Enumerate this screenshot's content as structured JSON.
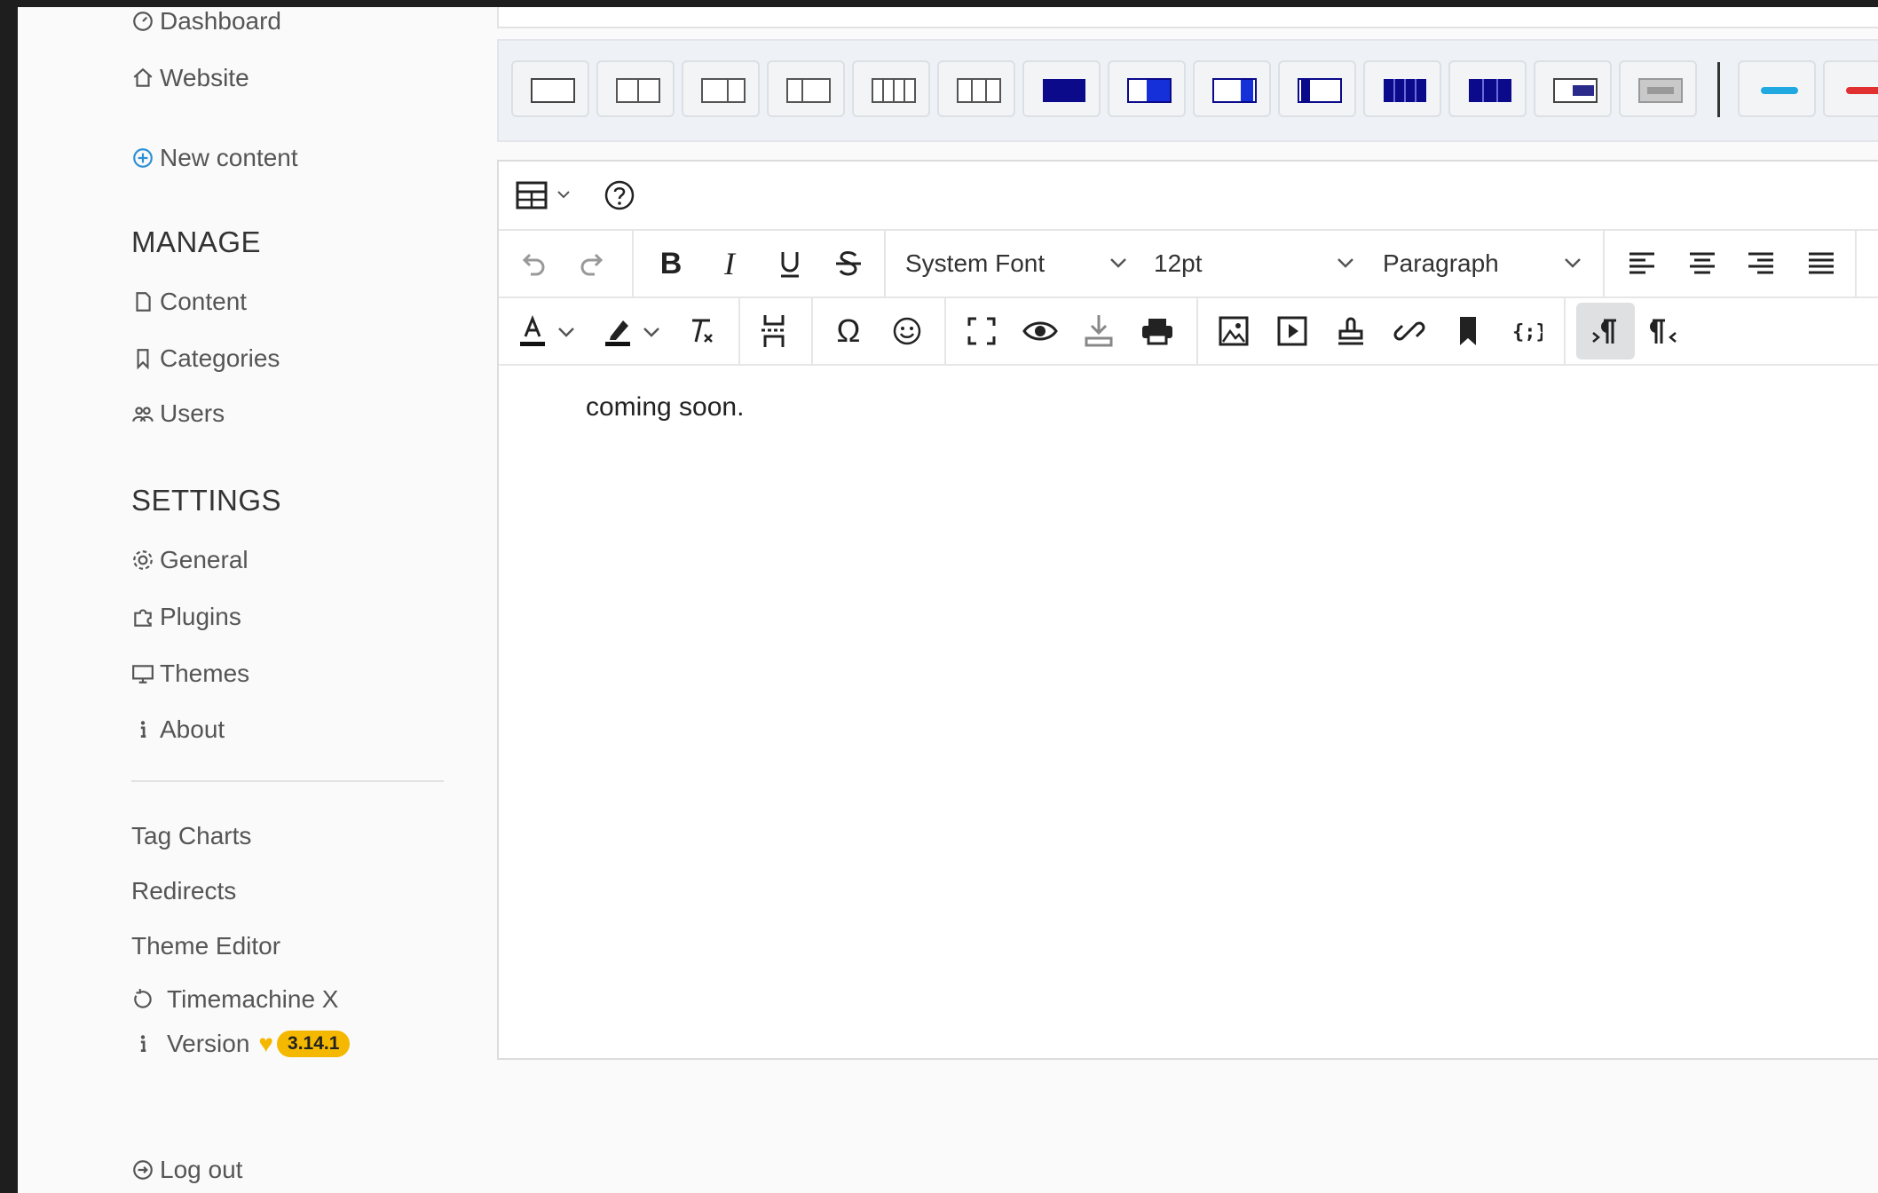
{
  "sidebar": {
    "top_items": [
      {
        "label": "Dashboard",
        "icon": "dashboard-icon"
      },
      {
        "label": "Website",
        "icon": "home-icon"
      },
      {
        "label": "New content",
        "icon": "plus-circle-icon"
      }
    ],
    "manage": {
      "heading": "MANAGE",
      "items": [
        {
          "label": "Content",
          "icon": "document-icon"
        },
        {
          "label": "Categories",
          "icon": "bookmark-icon"
        },
        {
          "label": "Users",
          "icon": "users-icon"
        }
      ]
    },
    "settings": {
      "heading": "SETTINGS",
      "items": [
        {
          "label": "General",
          "icon": "gear-icon"
        },
        {
          "label": "Plugins",
          "icon": "puzzle-icon"
        },
        {
          "label": "Themes",
          "icon": "monitor-icon"
        },
        {
          "label": "About",
          "icon": "info-icon"
        }
      ]
    },
    "plugins": [
      {
        "label": "Tag Charts"
      },
      {
        "label": "Redirects"
      },
      {
        "label": "Theme Editor"
      },
      {
        "label": "Timemachine X",
        "icon": "history-icon"
      }
    ],
    "version": {
      "label": "Version",
      "badge": "3.14.1",
      "icon": "info-icon",
      "heart_icon": "heart-icon"
    },
    "logout": {
      "label": "Log out",
      "icon": "logout-icon"
    }
  },
  "editor": {
    "font_family": "System Font",
    "font_size": "12pt",
    "block_format": "Paragraph",
    "content_text": "coming soon.",
    "layout_buttons": [
      "layout-1-col",
      "layout-2-col",
      "layout-2-col-right",
      "layout-2-col-left",
      "layout-4-col",
      "layout-3-col",
      "block-dark",
      "block-right-dark",
      "block-right-narrow",
      "block-left-narrow",
      "block-4-dark",
      "block-3-dark",
      "block-center",
      "block-grey",
      "line-blue",
      "line-red"
    ],
    "colors": {
      "accent_blue": "#2b8fd6",
      "badge": "#f5b800",
      "layout_dark": "#0a0a8a",
      "line_blue": "#20a8e0",
      "line_red": "#e03030"
    }
  }
}
